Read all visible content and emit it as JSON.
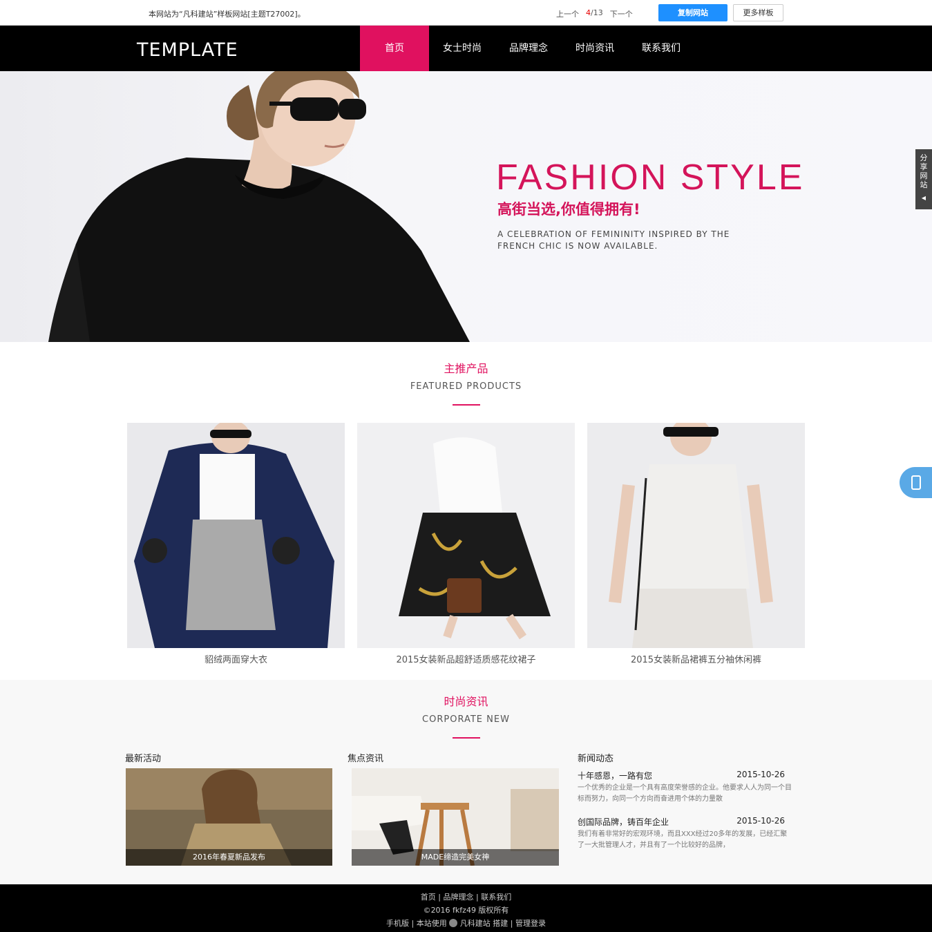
{
  "topbar": {
    "notice": "本网站为“凡科建站”样板网站[主题T27002]。",
    "prev": "上一个",
    "current": "4",
    "total": "/13",
    "next": "下一个",
    "copy_button": "复制网站",
    "more_button": "更多样板"
  },
  "nav": {
    "logo": "TEMPLATE",
    "items": [
      {
        "label": "首页",
        "active": true
      },
      {
        "label": "女士时尚"
      },
      {
        "label": "品牌理念"
      },
      {
        "label": "时尚资讯"
      },
      {
        "label": "联系我们"
      }
    ]
  },
  "banner": {
    "title": "FASHION STYLE",
    "subtitle": "高街当选,你值得拥有!",
    "desc": "A CELEBRATION OF FEMININITY INSPIRED BY THE FRENCH CHIC IS NOW AVAILABLE."
  },
  "share_tab": {
    "label": "分享网站",
    "arrow_icon": "caret-left-icon"
  },
  "mobile_tab": {
    "icon": "mobile-phone-icon"
  },
  "featured": {
    "title_cn": "主推产品",
    "title_en": "FEATURED PRODUCTS",
    "products": [
      {
        "caption": "貂绒两面穿大衣"
      },
      {
        "caption": "2015女装新品超舒适质感花纹裙子"
      },
      {
        "caption": "2015女装新品裙裤五分袖休闲裤"
      }
    ]
  },
  "news": {
    "title_cn": "时尚资讯",
    "title_en": "CORPORATE NEW",
    "columns": [
      {
        "title": "最新活动",
        "caption": "2016年春夏新品发布"
      },
      {
        "title": "焦点资讯",
        "caption": "MADE缔造完美女神"
      },
      {
        "title": "新闻动态"
      }
    ],
    "list": [
      {
        "title": "十年感恩，一路有您",
        "date": "2015-10-26",
        "summary": "一个优秀的企业是一个具有高度荣誉感的企业。他要求人人为同一个目标而努力，向同一个方向而奋进用个体的力量散"
      },
      {
        "title": "创国际品牌，铸百年企业",
        "date": "2015-10-26",
        "summary": "我们有着非常好的宏观环境，而且XXX经过20多年的发展，已经汇聚了一大批管理人才，并且有了一个比较好的品牌，"
      }
    ]
  },
  "footer": {
    "links": [
      "首页",
      "品牌理念",
      "联系我们"
    ],
    "copyright": "©2016 fkfz49 版权所有",
    "mobile": "手机版",
    "powered_prefix": "本站使用",
    "brand": "凡科建站",
    "build": "搭建",
    "admin": "管理登录"
  },
  "colors": {
    "accent": "#e0115f",
    "nav_bg": "#000000",
    "copy_btn": "#1e90ff"
  }
}
